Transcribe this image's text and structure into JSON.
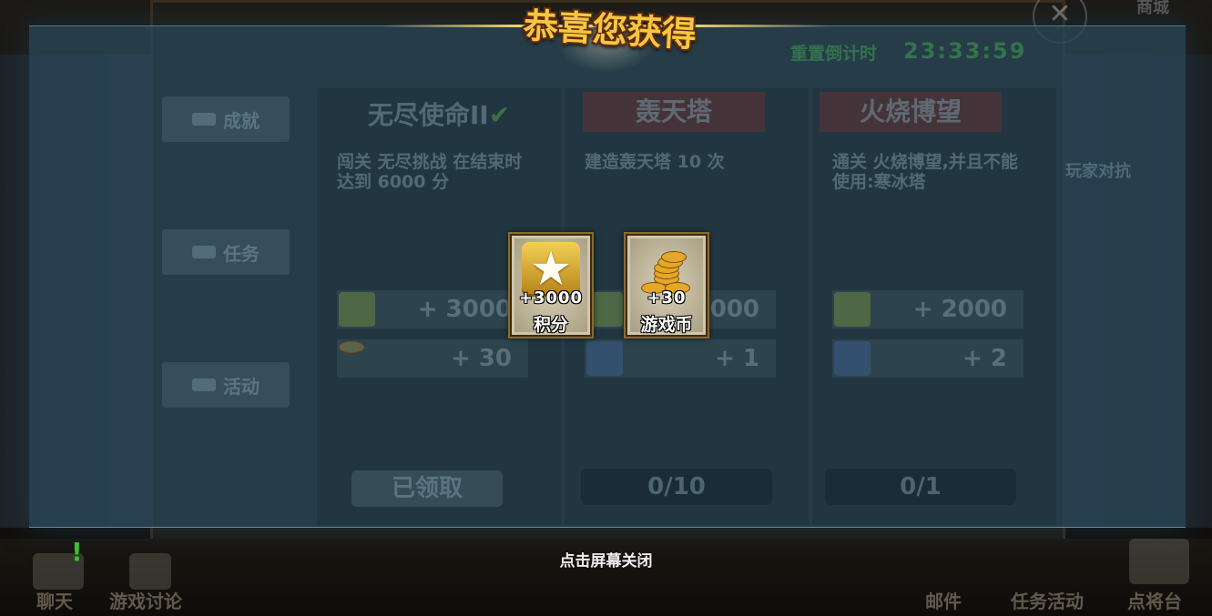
{
  "title": "恭喜您获得",
  "timer": {
    "label": "重置倒计时",
    "value": "23:33:59"
  },
  "shop_label": "商城",
  "close_symbol": "✕",
  "side_tabs": [
    {
      "label": "成就",
      "icon": "trophy-icon"
    },
    {
      "label": "任务",
      "icon": "quest-icon"
    },
    {
      "label": "活动",
      "icon": "lightning-icon"
    }
  ],
  "columns": [
    {
      "title": "无尽使命II",
      "check": "✔",
      "desc": "闯关 无尽挑战 在结束时达到 6000 分",
      "rewards": [
        {
          "icon": "star-icon",
          "value": "+ 3000"
        },
        {
          "icon": "coin-icon",
          "value": "+ 30"
        }
      ],
      "status": "已领取"
    },
    {
      "title": "轰天塔",
      "desc": "建造轰天塔 10 次",
      "rewards": [
        {
          "icon": "star-icon",
          "value": "+ 3000"
        },
        {
          "icon": "shield-icon",
          "value": "+ 1"
        }
      ],
      "status": "0/10"
    },
    {
      "title": "火烧博望",
      "desc": "通关 火烧博望,并且不能使用:寒冰塔",
      "rewards": [
        {
          "icon": "star-icon",
          "value": "+ 2000"
        },
        {
          "icon": "shield-icon",
          "value": "+ 2"
        }
      ],
      "status": "0/1"
    }
  ],
  "right_side_text": "玩家对抗",
  "rewards_popup": [
    {
      "icon": "star-icon",
      "amount": "+3000",
      "name": "积分"
    },
    {
      "icon": "coin-stack-icon",
      "amount": "+30",
      "name": "游戏币"
    }
  ],
  "tap_to_close": "点击屏幕关闭",
  "bottom_nav": [
    {
      "label": "聊天",
      "icon": "chat-icon"
    },
    {
      "label": "游戏讨论",
      "icon": "discussion-icon"
    },
    {
      "label": "邮件",
      "icon": "mail-icon"
    },
    {
      "label": "任务活动",
      "icon": "quest-icon"
    },
    {
      "label": "点将台",
      "icon": "banner-icon"
    }
  ],
  "colors": {
    "overlay": "#284456",
    "title_gold": "#f6c640",
    "timer_green": "#3c9650"
  }
}
